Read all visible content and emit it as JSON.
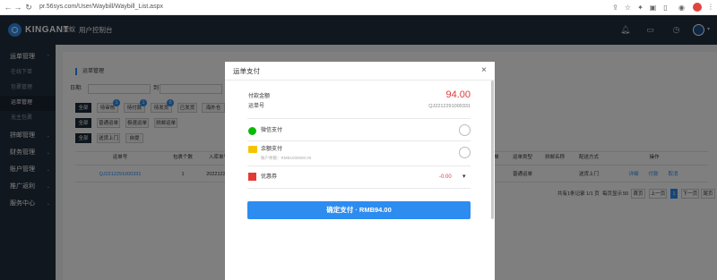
{
  "browser": {
    "url": "pr.56sys.com/User/Waybill/Waybill_List.aspx"
  },
  "header": {
    "logo_text": "KINGANT",
    "logo_cn": "金蚁",
    "title": "用户控制台"
  },
  "sidebar": {
    "items": [
      {
        "label": "运单管理",
        "expanded": true
      },
      {
        "label": "拼邮管理"
      },
      {
        "label": "财务管理"
      },
      {
        "label": "账户管理"
      },
      {
        "label": "推广返利"
      },
      {
        "label": "服务中心"
      }
    ],
    "subitems": [
      {
        "label": "在线下单"
      },
      {
        "label": "包裹管理"
      },
      {
        "label": "运单管理",
        "active": true
      },
      {
        "label": "无主包裹"
      }
    ]
  },
  "main": {
    "breadcrumb": "运单管理",
    "date_label": "日期:",
    "date_to": "到",
    "status_tabs": [
      {
        "label": "全部",
        "active": true
      },
      {
        "label": "待审核",
        "badge": "1"
      },
      {
        "label": "待付款",
        "badge": "1"
      },
      {
        "label": "待发货",
        "badge": "0"
      },
      {
        "label": "已发货"
      },
      {
        "label": "海外仓"
      }
    ],
    "type_tabs": [
      {
        "label": "全部",
        "active": true
      },
      {
        "label": "普通运单"
      },
      {
        "label": "极速运单"
      },
      {
        "label": "拼邮运单"
      }
    ],
    "delivery_tabs": [
      {
        "label": "全部",
        "active": true
      },
      {
        "label": "送货上门"
      },
      {
        "label": "自提"
      }
    ],
    "table": {
      "headers": [
        "运单号",
        "包裹个数",
        "入库单号",
        "单",
        "运单类型",
        "拼邮名称",
        "配送方式",
        "操作"
      ],
      "row": {
        "waybill_no": "QJ2212291000331",
        "packages": "1",
        "inbound_no": "202212291",
        "type": "普通运单",
        "delivery": "送货上门",
        "actions": [
          "详细",
          "付款",
          "取消"
        ]
      }
    },
    "pager": {
      "summary": "共有1条记录  1/1 页",
      "per_page_label": "每页显示",
      "per_page": "50",
      "items": [
        "首页",
        "上一页",
        "1",
        "下一页",
        "尾页"
      ]
    }
  },
  "modal": {
    "title": "运单支付",
    "close": "×",
    "amount_label": "付款金额",
    "amount": "94.00",
    "order_label": "运单号",
    "order_no": "QJ2212291000331",
    "wechat_label": "微信支付",
    "balance_label": "余额支付",
    "balance_sub": "账户余额：RMB1000000.00",
    "coupon_label": "优惠券",
    "coupon_value": "-0.00",
    "confirm_label": "确定支付 · RMB94.00"
  },
  "colors": {
    "accent": "#2d8cf0",
    "header_bg": "#232f3e",
    "price_red": "#e03b3b"
  }
}
